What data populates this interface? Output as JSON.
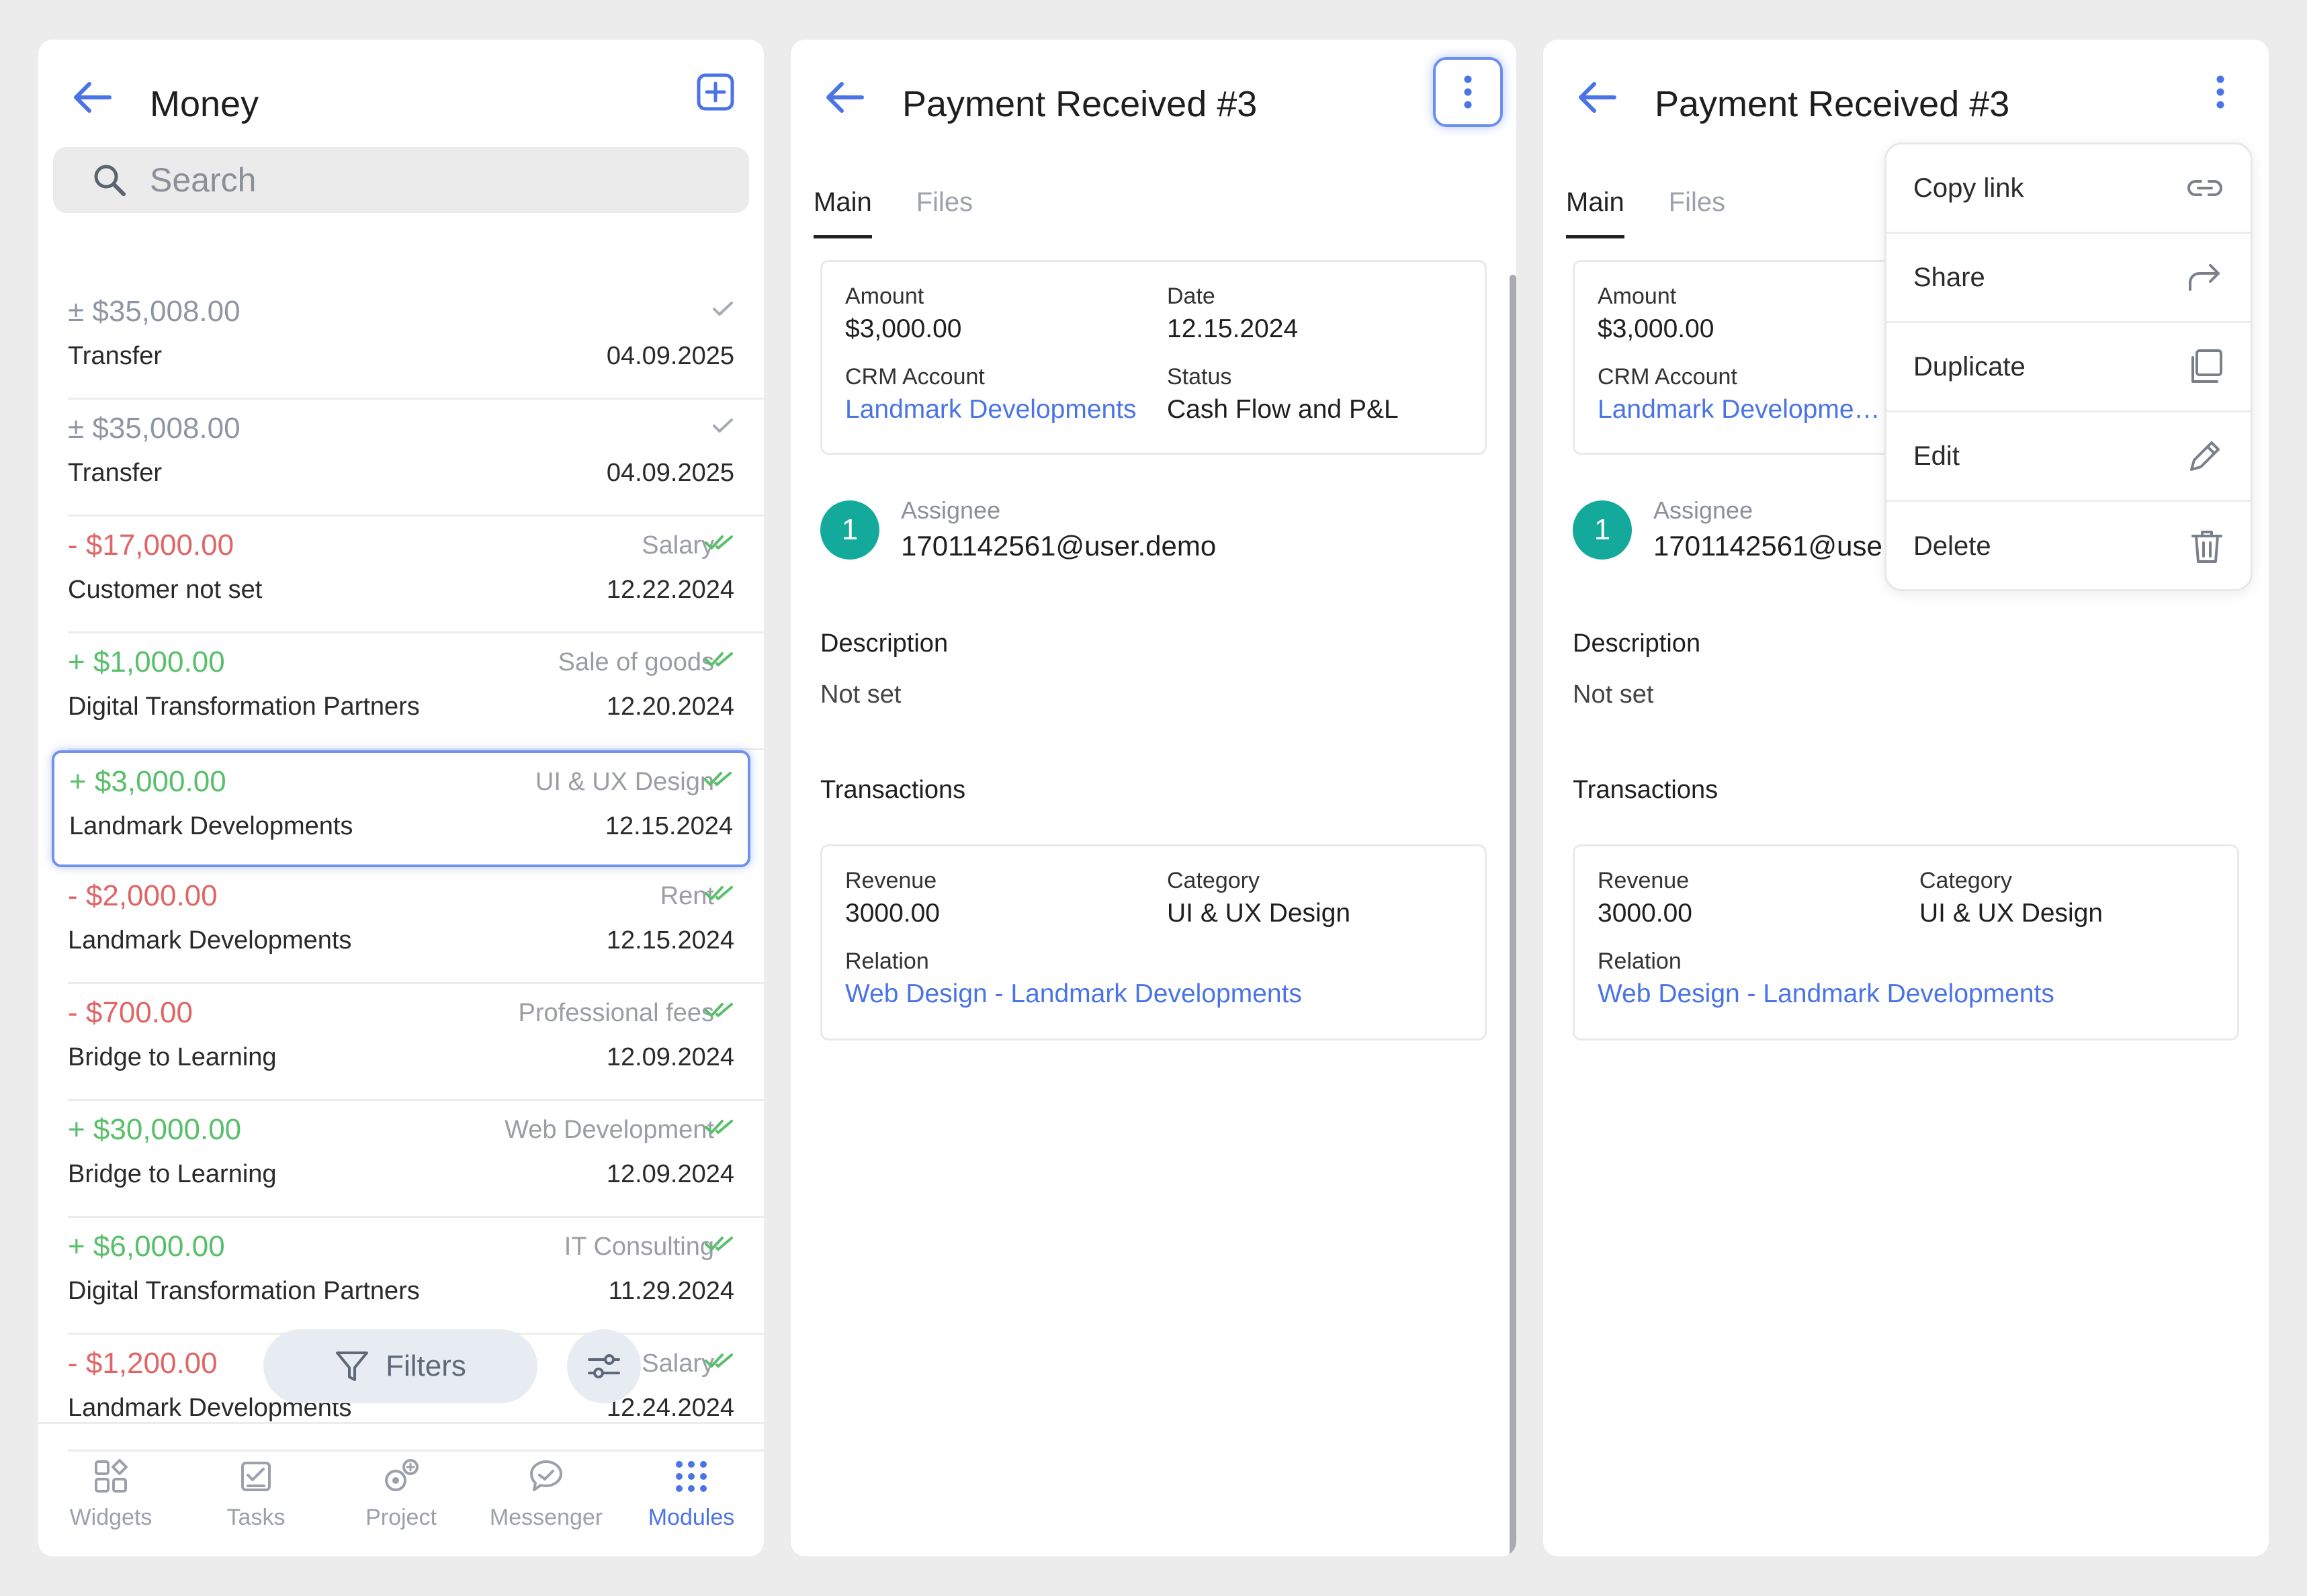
{
  "colors": {
    "accent": "#4a74e6",
    "positive": "#58bf6a",
    "negative": "#e06666",
    "avatar": "#13a99b"
  },
  "list_panel": {
    "title": "Money",
    "search_placeholder": "Search",
    "rows": [
      {
        "amount": "± $35,008.00",
        "sign": "neu",
        "category": "",
        "counterparty": "Transfer",
        "date": "04.09.2025",
        "check": "single-check-icon"
      },
      {
        "amount": "± $35,008.00",
        "sign": "neu",
        "category": "",
        "counterparty": "Transfer",
        "date": "04.09.2025",
        "check": "single-check-icon"
      },
      {
        "amount": "- $17,000.00",
        "sign": "neg",
        "category": "Salary",
        "counterparty": "Customer not set",
        "date": "12.22.2024",
        "check": "double-check-icon"
      },
      {
        "amount": "+ $1,000.00",
        "sign": "pos",
        "category": "Sale of goods",
        "counterparty": "Digital Transformation Partners",
        "date": "12.20.2024",
        "check": "double-check-icon"
      },
      {
        "amount": "+ $3,000.00",
        "sign": "pos",
        "category": "UI & UX Design",
        "counterparty": "Landmark Developments",
        "date": "12.15.2024",
        "check": "double-check-icon"
      },
      {
        "amount": "- $2,000.00",
        "sign": "neg",
        "category": "Rent",
        "counterparty": "Landmark Developments",
        "date": "12.15.2024",
        "check": "double-check-icon"
      },
      {
        "amount": "- $700.00",
        "sign": "neg",
        "category": "Professional fees",
        "counterparty": "Bridge to Learning",
        "date": "12.09.2024",
        "check": "double-check-icon"
      },
      {
        "amount": "+ $30,000.00",
        "sign": "pos",
        "category": "Web Development",
        "counterparty": "Bridge to Learning",
        "date": "12.09.2024",
        "check": "double-check-icon"
      },
      {
        "amount": "+ $6,000.00",
        "sign": "pos",
        "category": "IT Consulting",
        "counterparty": "Digital Transformation Partners",
        "date": "11.29.2024",
        "check": "double-check-icon"
      },
      {
        "amount": "- $1,200.00",
        "sign": "neg",
        "category": "Salary",
        "counterparty": "Landmark Developments",
        "date": "12.24.2024",
        "check": "double-check-icon"
      }
    ],
    "filters_label": "Filters",
    "nav": [
      {
        "label": "Widgets",
        "icon": "widgets-icon"
      },
      {
        "label": "Tasks",
        "icon": "tasks-icon"
      },
      {
        "label": "Project",
        "icon": "project-icon"
      },
      {
        "label": "Messenger",
        "icon": "messenger-icon"
      },
      {
        "label": "Modules",
        "icon": "modules-icon"
      }
    ]
  },
  "detail": {
    "title": "Payment Received #3",
    "tabs": [
      "Main",
      "Files"
    ],
    "amount_label": "Amount",
    "amount_value": "$3,000.00",
    "date_label": "Date",
    "date_value": "12.15.2024",
    "crm_label": "CRM Account",
    "crm_value": "Landmark Developments",
    "status_label": "Status",
    "status_value": "Cash Flow and P&L",
    "assignee_badge": "1",
    "assignee_label": "Assignee",
    "assignee_value": "1701142561@user.demo",
    "description_label": "Description",
    "description_value": "Not set",
    "transactions_label": "Transactions",
    "revenue_label": "Revenue",
    "revenue_value": "3000.00",
    "category_label": "Category",
    "category_value": "UI & UX Design",
    "relation_label": "Relation",
    "relation_value": "Web Design - Landmark Developments"
  },
  "menu": [
    {
      "label": "Copy link",
      "icon": "link-icon"
    },
    {
      "label": "Share",
      "icon": "share-icon"
    },
    {
      "label": "Duplicate",
      "icon": "duplicate-icon"
    },
    {
      "label": "Edit",
      "icon": "edit-icon"
    },
    {
      "label": "Delete",
      "icon": "trash-icon"
    }
  ]
}
